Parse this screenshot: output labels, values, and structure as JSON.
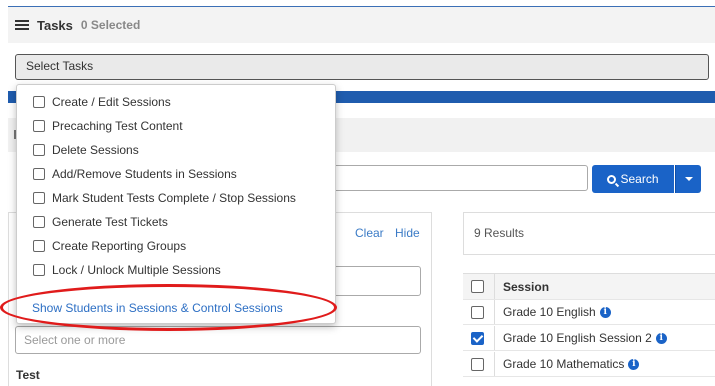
{
  "tasks": {
    "title": "Tasks",
    "selected_count": "0 Selected",
    "select_placeholder": "Select Tasks"
  },
  "dropdown": {
    "items": [
      "Create / Edit Sessions",
      "Precaching Test Content",
      "Delete Sessions",
      "Add/Remove Students in Sessions",
      "Mark Student Tests Complete / Stop Sessions",
      "Generate Test Tickets",
      "Create Reporting Groups",
      "Lock / Unlock Multiple Sessions"
    ],
    "link": "Show Students in Sessions & Control Sessions"
  },
  "search": {
    "button_label": "Search"
  },
  "filters": {
    "clear": "Clear",
    "hide": "Hide",
    "select_placeholder": "Select one or more",
    "test_label": "Test"
  },
  "results": {
    "count": "9 Results",
    "column_header": "Session",
    "rows": [
      {
        "name": "Grade 10 English",
        "checked": false
      },
      {
        "name": "Grade 10 English Session 2",
        "checked": true
      },
      {
        "name": "Grade 10 Mathematics",
        "checked": false
      }
    ]
  },
  "colors": {
    "accent": "#1a63c7",
    "highlight_ring": "#e01b1b",
    "link": "#2d6fc4"
  }
}
